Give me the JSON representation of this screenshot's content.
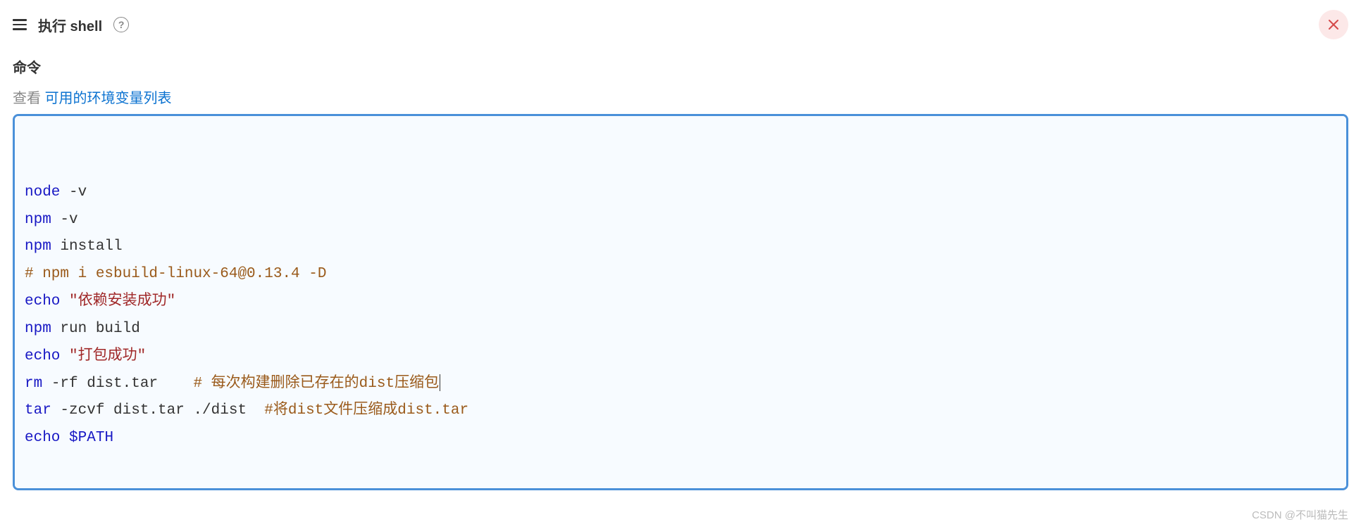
{
  "header": {
    "title": "执行 shell",
    "help_label": "?"
  },
  "section": {
    "label": "命令",
    "hint_prefix": "查看 ",
    "hint_link": "可用的环境变量列表"
  },
  "code": {
    "lines": [
      {
        "tokens": [
          {
            "t": "cmd",
            "v": "node"
          },
          {
            "t": "arg",
            "v": " -v"
          }
        ]
      },
      {
        "tokens": [
          {
            "t": "cmd",
            "v": "npm"
          },
          {
            "t": "arg",
            "v": " -v"
          }
        ]
      },
      {
        "tokens": [
          {
            "t": "cmd",
            "v": "npm"
          },
          {
            "t": "arg",
            "v": " install"
          }
        ]
      },
      {
        "tokens": [
          {
            "t": "comment",
            "v": "# npm i esbuild-linux-64@0.13.4 -D"
          }
        ]
      },
      {
        "tokens": [
          {
            "t": "cmd",
            "v": "echo"
          },
          {
            "t": "arg",
            "v": " "
          },
          {
            "t": "string",
            "v": "\"依赖安装成功\""
          }
        ]
      },
      {
        "tokens": [
          {
            "t": "cmd",
            "v": "npm"
          },
          {
            "t": "arg",
            "v": " run build"
          }
        ]
      },
      {
        "tokens": [
          {
            "t": "cmd",
            "v": "echo"
          },
          {
            "t": "arg",
            "v": " "
          },
          {
            "t": "string",
            "v": "\"打包成功\""
          }
        ]
      },
      {
        "tokens": [
          {
            "t": "cmd",
            "v": "rm"
          },
          {
            "t": "arg",
            "v": " -rf dist.tar    "
          },
          {
            "t": "comment",
            "v": "# 每次构建删除已存在的dist压缩包"
          }
        ],
        "caret": true
      },
      {
        "tokens": [
          {
            "t": "cmd",
            "v": "tar"
          },
          {
            "t": "arg",
            "v": " -zcvf dist.tar ./dist  "
          },
          {
            "t": "comment",
            "v": "#将dist文件压缩成dist.tar"
          }
        ]
      },
      {
        "tokens": [
          {
            "t": "cmd",
            "v": "echo"
          },
          {
            "t": "arg",
            "v": " "
          },
          {
            "t": "var",
            "v": "$PATH"
          }
        ]
      }
    ]
  },
  "watermark": "CSDN @不叫猫先生"
}
